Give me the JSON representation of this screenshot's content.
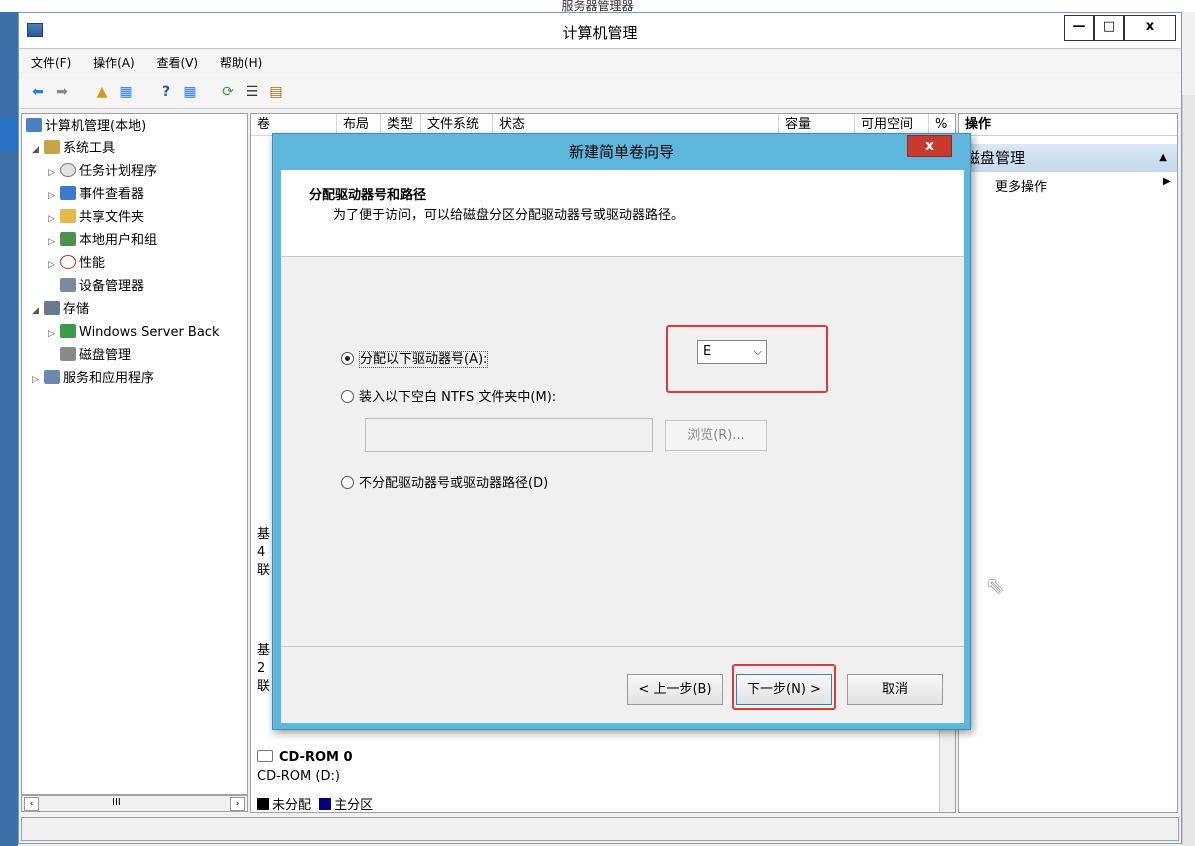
{
  "background_window": {
    "title": "服务器管理器",
    "controls": [
      "—",
      "□",
      "x"
    ]
  },
  "window": {
    "title": "计算机管理",
    "controls": [
      "—",
      "□",
      "x"
    ]
  },
  "menu": [
    "文件(F)",
    "操作(A)",
    "查看(V)",
    "帮助(H)"
  ],
  "tree": {
    "root": "计算机管理(本地)",
    "system_tools": "系统工具",
    "task_scheduler": "任务计划程序",
    "event_viewer": "事件查看器",
    "shared_folders": "共享文件夹",
    "local_users": "本地用户和组",
    "performance": "性能",
    "device_manager": "设备管理器",
    "storage": "存储",
    "windows_backup": "Windows Server Back",
    "disk_management": "磁盘管理",
    "services_apps": "服务和应用程序",
    "hscroll_thumb": "III"
  },
  "columns": [
    "卷",
    "布局",
    "类型",
    "文件系统",
    "状态",
    "容量",
    "可用空间",
    "%"
  ],
  "center": {
    "partial_labels": [
      "基",
      "4",
      "联",
      "基",
      "2",
      "联"
    ],
    "cdrom_title": "CD-ROM 0",
    "cdrom_drive": "CD-ROM (D:)",
    "legend_unallocated": "未分配",
    "legend_primary": "主分区",
    "legend_primary_color": "#00007f"
  },
  "actions": {
    "header": "操作",
    "section": "磁盘管理",
    "more": "更多操作"
  },
  "wizard": {
    "title": "新建简单卷向导",
    "close": "x",
    "heading": "分配驱动器号和路径",
    "description": "为了便于访问，可以给磁盘分区分配驱动器号或驱动器路径。",
    "option_assign": "分配以下驱动器号(A):",
    "drive_letter": "E",
    "option_mount": "装入以下空白 NTFS 文件夹中(M):",
    "browse": "浏览(R)...",
    "option_none": "不分配驱动器号或驱动器路径(D)",
    "back": "< 上一步(B)",
    "next": "下一步(N) >",
    "cancel": "取消",
    "highlight_color": "#e23a3a"
  }
}
